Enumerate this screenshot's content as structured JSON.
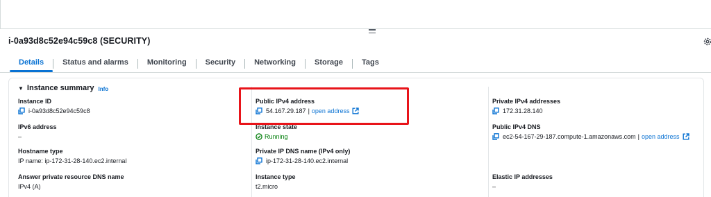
{
  "instance": {
    "title": "i-0a93d8c52e94c59c8 (SECURITY)"
  },
  "tabs": [
    {
      "label": "Details",
      "active": true
    },
    {
      "label": "Status and alarms",
      "active": false
    },
    {
      "label": "Monitoring",
      "active": false
    },
    {
      "label": "Security",
      "active": false
    },
    {
      "label": "Networking",
      "active": false
    },
    {
      "label": "Storage",
      "active": false
    },
    {
      "label": "Tags",
      "active": false
    }
  ],
  "summary": {
    "heading": "Instance summary",
    "info": "Info",
    "instance_id": {
      "label": "Instance ID",
      "value": "i-0a93d8c52e94c59c8"
    },
    "ipv6": {
      "label": "IPv6 address",
      "value": "–"
    },
    "hostname": {
      "label": "Hostname type",
      "value": "IP name: ip-172-31-28-140.ec2.internal"
    },
    "answer_dns": {
      "label": "Answer private resource DNS name",
      "value": "IPv4 (A)"
    },
    "public_ipv4": {
      "label": "Public IPv4 address",
      "value": "54.167.29.187",
      "sep": "|",
      "link": "open address"
    },
    "instance_state": {
      "label": "Instance state",
      "value": "Running"
    },
    "private_dns": {
      "label": "Private IP DNS name (IPv4 only)",
      "value": "ip-172-31-28-140.ec2.internal"
    },
    "instance_type": {
      "label": "Instance type",
      "value": "t2.micro"
    },
    "private_ipv4": {
      "label": "Private IPv4 addresses",
      "value": "172.31.28.140"
    },
    "public_dns": {
      "label": "Public IPv4 DNS",
      "value": "ec2-54-167-29-187.compute-1.amazonaws.com",
      "sep": "|",
      "link": "open address"
    },
    "elastic_ip": {
      "label": "Elastic IP addresses",
      "value": "–"
    }
  },
  "colors": {
    "accent": "#0972d3",
    "success": "#037f0c",
    "highlight": "#e8141a"
  },
  "icons": [
    "drag-handle-icon",
    "gear-icon",
    "caret-down-icon",
    "copy-icon",
    "external-link-icon",
    "check-circle-icon"
  ]
}
